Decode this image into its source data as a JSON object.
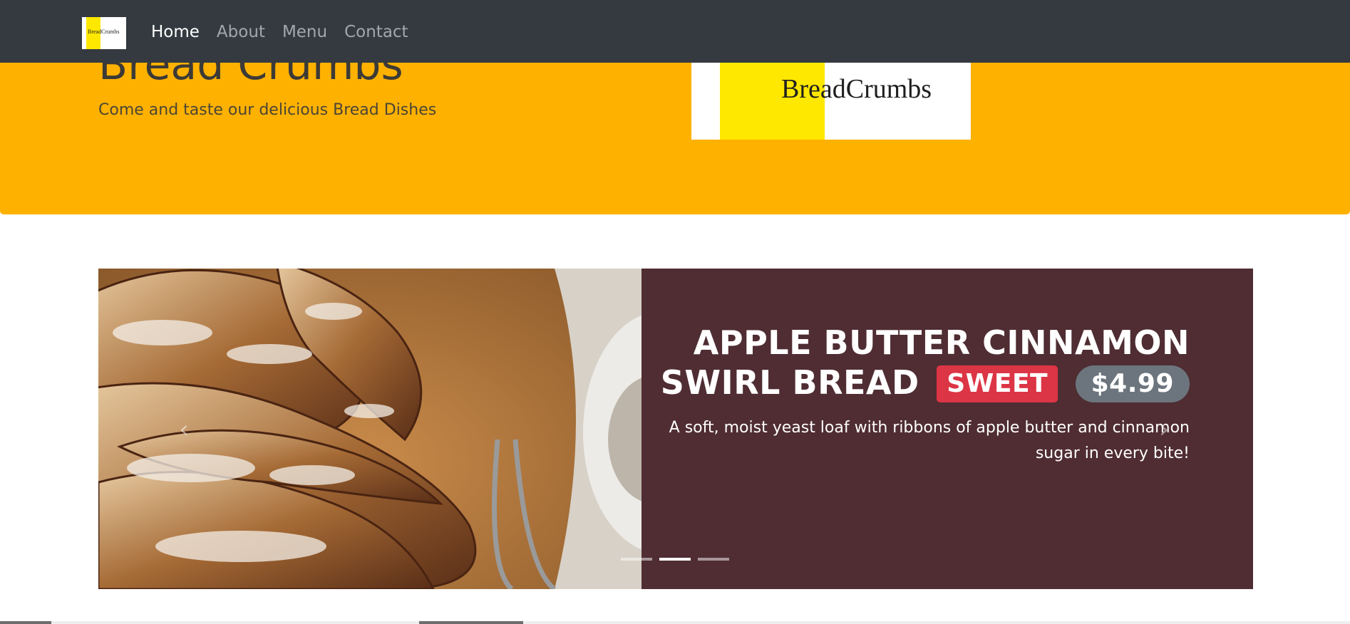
{
  "navbar": {
    "logo_text": "BreadCrumbs",
    "links": [
      {
        "label": "Home",
        "active": true
      },
      {
        "label": "About",
        "active": false
      },
      {
        "label": "Menu",
        "active": false
      },
      {
        "label": "Contact",
        "active": false
      }
    ]
  },
  "jumbotron": {
    "title": "Bread Crumbs",
    "subtitle": "Come and taste our delicious Bread Dishes",
    "logo_text": "BreadCrumbs"
  },
  "carousel": {
    "slide": {
      "title": "APPLE BUTTER CINNAMON SWIRL BREAD",
      "tag": "SWEET",
      "price": "$4.99",
      "description": "A soft, moist yeast loaf with ribbons of apple butter and cinnamon sugar in every bite!"
    },
    "controls": {
      "prev": "‹",
      "next": "›"
    },
    "indicators": 3,
    "active_indicator": 1
  },
  "colors": {
    "navbar_bg": "#343a40",
    "jumbotron_bg": "#ffb100",
    "slide_bg": "#4f2d33",
    "badge_sweet": "#dc3545",
    "badge_price": "#6c757d"
  }
}
